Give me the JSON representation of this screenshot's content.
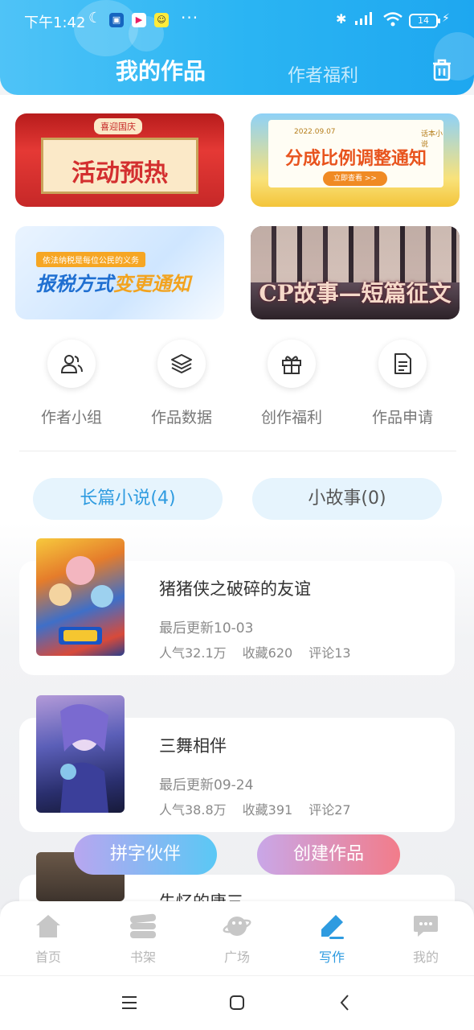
{
  "status_bar": {
    "time": "下午1:42",
    "battery": "14",
    "more": "···"
  },
  "header": {
    "tab_active": "我的作品",
    "tab_inactive": "作者福利"
  },
  "banners": [
    {
      "tag": "喜迎国庆",
      "title": "活动预热"
    },
    {
      "date": "2022.09.07",
      "brand": "话本小说",
      "title": "分成比例调整通知",
      "button": "立即查看 >>"
    },
    {
      "subtitle": "依法纳税是每位公民的义务",
      "title_part1": "报税方式",
      "title_part2": "变更通知"
    },
    {
      "title": "CP故事—短篇征文"
    }
  ],
  "quick_actions": [
    {
      "label": "作者小组",
      "icon": "group-icon"
    },
    {
      "label": "作品数据",
      "icon": "layers-icon"
    },
    {
      "label": "创作福利",
      "icon": "gift-icon"
    },
    {
      "label": "作品申请",
      "icon": "document-icon"
    }
  ],
  "tabs": {
    "long": "长篇小说(4)",
    "short": "小故事(0)"
  },
  "works": [
    {
      "title": "猪猪侠之破碎的友谊",
      "updated": "最后更新10-03",
      "popularity": "人气32.1万",
      "favorites": "收藏620",
      "comments": "评论13"
    },
    {
      "title": "三舞相伴",
      "updated": "最后更新09-24",
      "popularity": "人气38.8万",
      "favorites": "收藏391",
      "comments": "评论27"
    },
    {
      "title": "失忆的唐三"
    }
  ],
  "floating_buttons": {
    "partner": "拼字伙伴",
    "create": "创建作品"
  },
  "bottom_nav": [
    {
      "label": "首页",
      "icon": "home-icon"
    },
    {
      "label": "书架",
      "icon": "bookshelf-icon"
    },
    {
      "label": "广场",
      "icon": "planet-icon"
    },
    {
      "label": "写作",
      "icon": "pen-icon",
      "active": true
    },
    {
      "label": "我的",
      "icon": "chat-icon"
    }
  ],
  "colors": {
    "accent": "#2e9be0",
    "header_gradient_start": "#4fc3f7",
    "header_gradient_end": "#1ea7f0"
  }
}
